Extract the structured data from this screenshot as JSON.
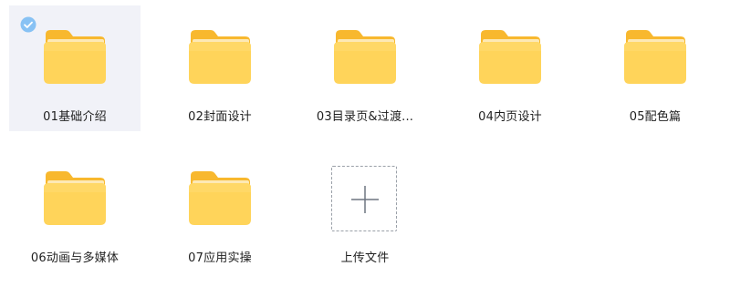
{
  "folders": [
    {
      "name": "01基础介绍",
      "selected": true
    },
    {
      "name": "02封面设计",
      "selected": false
    },
    {
      "name": "03目录页&过渡...",
      "selected": false
    },
    {
      "name": "04内页设计",
      "selected": false
    },
    {
      "name": "05配色篇",
      "selected": false
    },
    {
      "name": "06动画与多媒体",
      "selected": false
    },
    {
      "name": "07应用实操",
      "selected": false
    }
  ],
  "upload": {
    "label": "上传文件"
  },
  "colors": {
    "folder_back": "#f8b82e",
    "folder_front": "#ffd45a",
    "selected_bg": "#f1f2f8",
    "check": "#88c2f4"
  },
  "icons": {
    "folder": "folder-icon",
    "check": "check-circle-icon",
    "upload": "plus-icon"
  }
}
